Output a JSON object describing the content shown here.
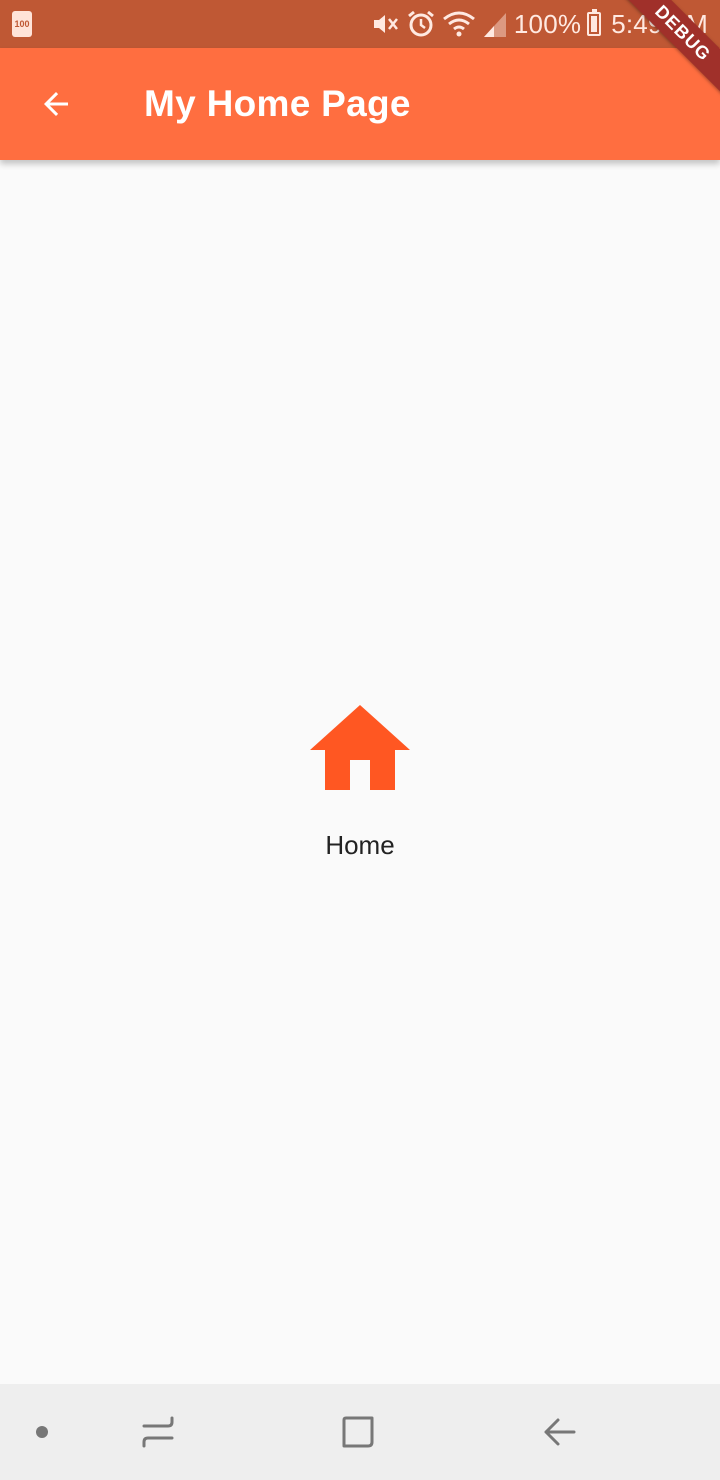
{
  "status_bar": {
    "battery_notification": "100",
    "battery_percent": "100%",
    "time": "5:49 AM",
    "icons": [
      "battery-notification-icon",
      "mute-icon",
      "alarm-icon",
      "wifi-icon",
      "signal-icon",
      "battery-icon"
    ]
  },
  "app_bar": {
    "title": "My Home Page",
    "back_icon": "arrow-back-icon",
    "color": "#FF6E40"
  },
  "debug_banner": {
    "label": "DEBUG",
    "color": "#A0302A"
  },
  "content": {
    "icon": "home-icon",
    "icon_color": "#FF5722",
    "label": "Home"
  },
  "nav_bar": {
    "items": [
      "dot-indicator",
      "recents-icon",
      "home-icon",
      "back-icon"
    ]
  },
  "colors": {
    "status_bar": "#BF5834",
    "background": "#FAFAFA",
    "nav_bar": "#EEEEEE"
  }
}
